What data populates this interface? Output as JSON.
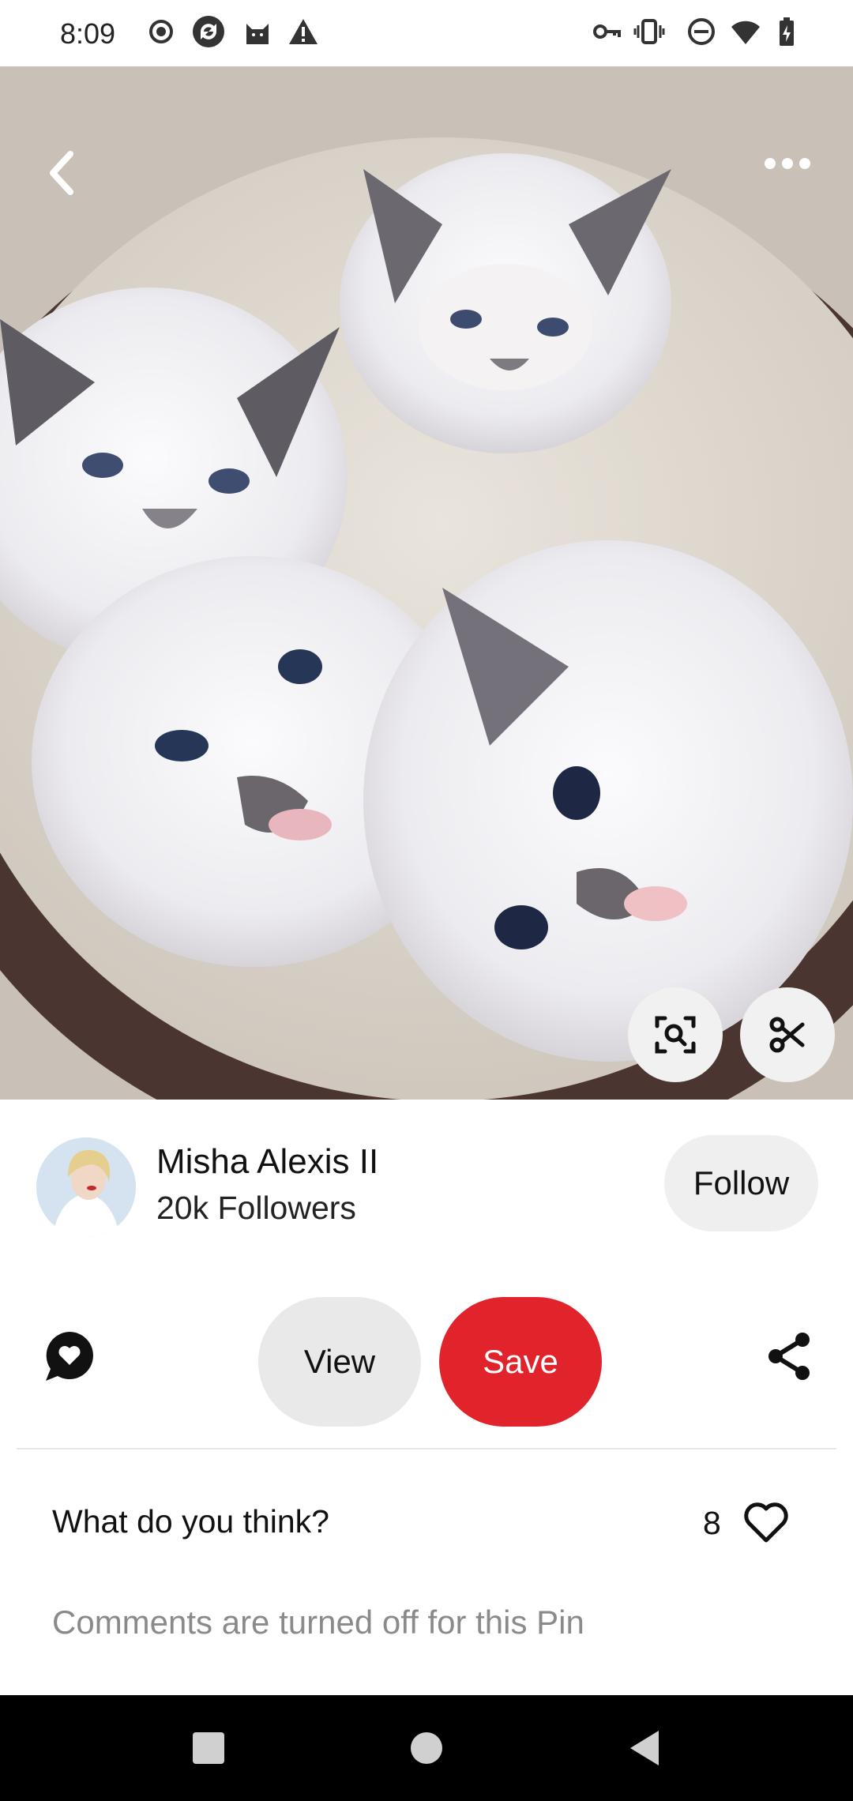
{
  "status_bar": {
    "time": "8:09",
    "left_icons": [
      "record-icon",
      "sync-icon",
      "cat-app-icon",
      "warning-icon"
    ],
    "right_icons": [
      "vpn-key-icon",
      "vibrate-icon",
      "do-not-disturb-icon",
      "wifi-icon",
      "battery-charging-icon"
    ]
  },
  "pin": {
    "image_description_icon": "kittens-photo",
    "back_icon": "back-chevron-icon",
    "more_icon": "more-options-icon",
    "visual_search_icon": "visual-search-icon",
    "cutout_icon": "scissors-icon"
  },
  "creator": {
    "name": "Misha Alexis II",
    "followers": "20k Followers",
    "follow_label": "Follow"
  },
  "actions": {
    "comment_icon": "chat-heart-icon",
    "view_label": "View",
    "save_label": "Save",
    "share_icon": "share-icon"
  },
  "comments": {
    "prompt": "What do you think?",
    "like_count": "8",
    "off_message": "Comments are turned off for this Pin"
  },
  "colors": {
    "save_red": "#e1232b",
    "pill_gray": "#e9e9e9"
  },
  "nav": {
    "icons": [
      "recents-square-icon",
      "home-circle-icon",
      "back-triangle-icon"
    ]
  }
}
